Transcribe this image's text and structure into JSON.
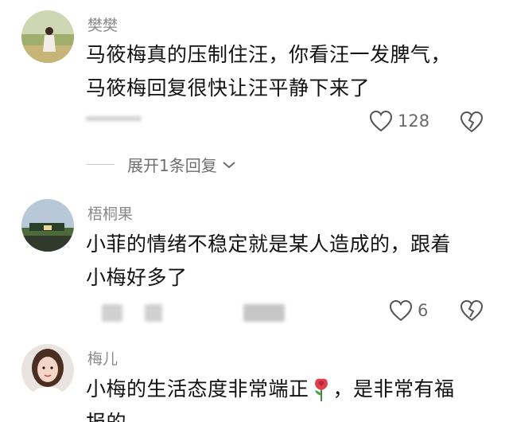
{
  "comments": [
    {
      "username": "樊樊",
      "lines": [
        "马筱梅真的压制住汪，你看汪一发脾气，",
        "马筱梅回复很快让汪平静下来了"
      ],
      "likes": "128",
      "expand": "展开1条回复"
    },
    {
      "username": "梧桐果",
      "lines": [
        "小菲的情绪不稳定就是某人造成的，跟着",
        "小梅好多了"
      ],
      "likes": "6"
    },
    {
      "username": "梅儿",
      "lines": [
        "小梅的生活态度非常端正",
        "，是非常有福"
      ],
      "tail": "报的"
    }
  ],
  "icons": {
    "like": "heart-outline-icon",
    "dislike": "broken-heart-icon",
    "expand": "chevron-down-icon",
    "emoji": "rose-emoji"
  },
  "colors": {
    "username": "#8a8a8a",
    "content": "#121212",
    "meta": "#6a6a6a"
  }
}
